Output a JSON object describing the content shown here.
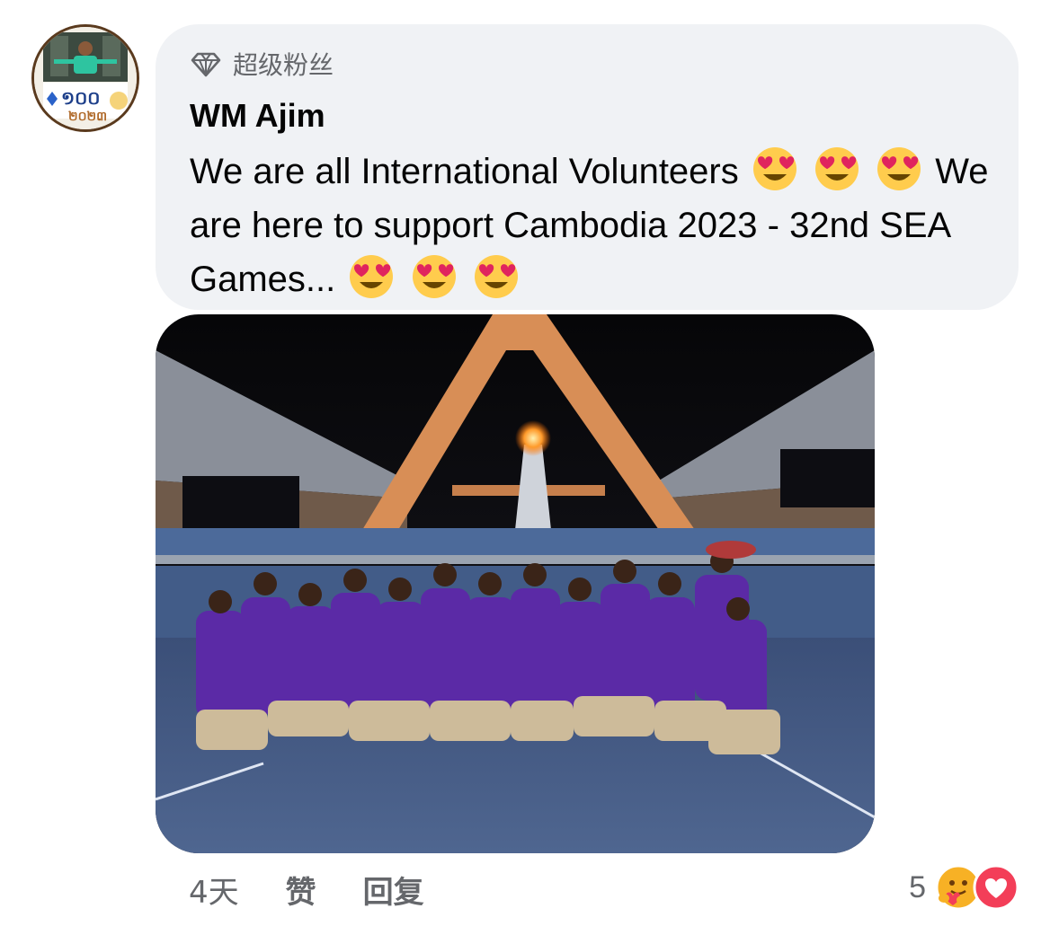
{
  "comment": {
    "badge_icon": "diamond-icon",
    "badge_label": "超级粉丝",
    "author": "WM Ajim",
    "text_part1": "We are all International Volunteers",
    "text_part2": "We are here to support Cambodia 2023 - 32nd SEA Games...",
    "emoji_name": "heart-eyes-emoji"
  },
  "photo": {
    "description_icon": "comment-photo"
  },
  "actions": {
    "time": "4天",
    "like_label": "赞",
    "reply_label": "回复"
  },
  "reactions": {
    "count": "5",
    "icons": [
      "care-reaction-icon",
      "love-reaction-icon"
    ]
  },
  "colors": {
    "bubble": "#f0f2f5",
    "secondary_text": "#65676b",
    "love_red": "#f33e58",
    "care_yellow": "#f7b125"
  }
}
